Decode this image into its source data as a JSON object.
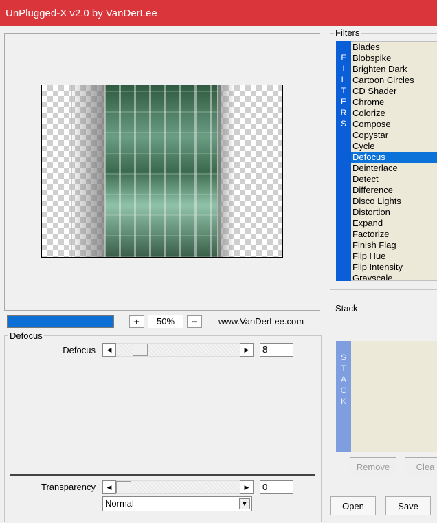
{
  "window": {
    "title": "UnPlugged-X v2.0 by VanDerLee"
  },
  "preview": {
    "progress": 1.0,
    "zoom_in_label": "+",
    "zoom_value": "50%",
    "zoom_out_label": "−",
    "website": "www.VanDerLee.com"
  },
  "filters": {
    "group_label": "Filters",
    "sidebar_letters": [
      "F",
      "I",
      "L",
      "T",
      "E",
      "R",
      "S"
    ],
    "items": [
      "Blades",
      "Blobspike",
      "Brighten Dark",
      "Cartoon Circles",
      "CD Shader",
      "Chrome",
      "Colorize",
      "Compose",
      "Copystar",
      "Cycle",
      "Defocus",
      "Deinterlace",
      "Detect",
      "Difference",
      "Disco Lights",
      "Distortion",
      "Expand",
      "Factorize",
      "Finish Flag",
      "Flip Hue",
      "Flip Intensity",
      "Grayscale"
    ],
    "selected": "Defocus"
  },
  "stack": {
    "group_label": "Stack",
    "sidebar_letters": [
      "S",
      "T",
      "A",
      "C",
      "K"
    ],
    "remove_label": "Remove",
    "clear_label": "Clea"
  },
  "params": {
    "group_label": "Defocus",
    "defocus_label": "Defocus",
    "defocus_value": "8",
    "transparency_label": "Transparency",
    "transparency_value": "0",
    "blend_mode": "Normal"
  },
  "footer": {
    "open_label": "Open",
    "save_label": "Save"
  },
  "colors": {
    "titlebar": "#d9353a",
    "accent": "#0a72d8",
    "list_bg": "#ece9d8"
  }
}
